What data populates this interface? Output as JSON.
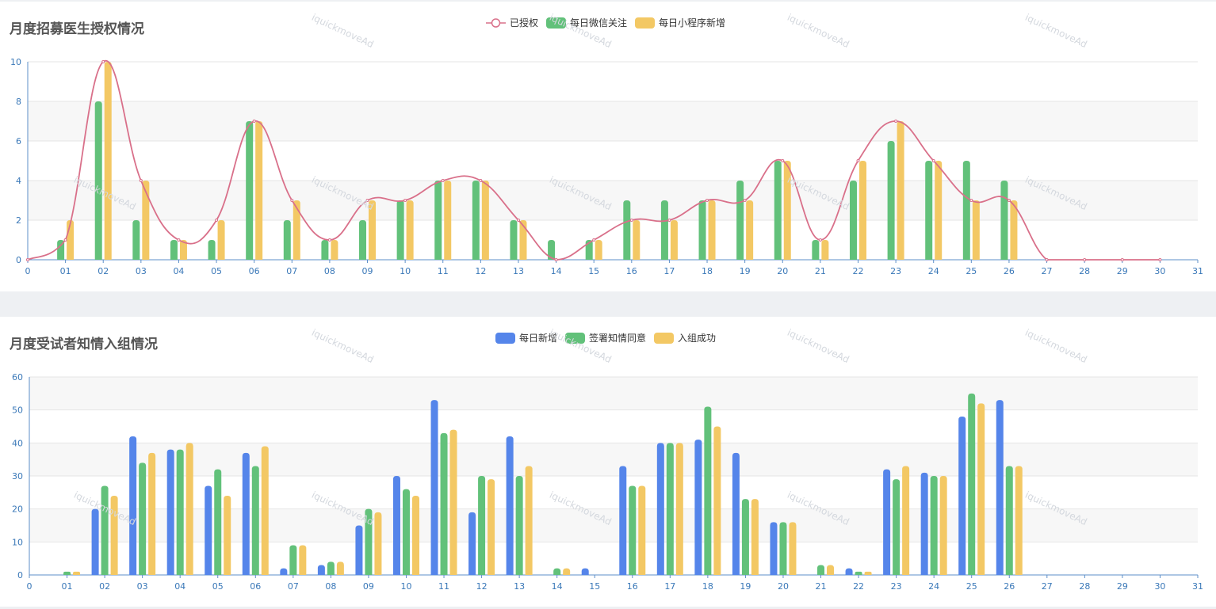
{
  "watermark": "iquickmoveAd",
  "colors": {
    "pink": "#d9708a",
    "green": "#62c17a",
    "yellow": "#f3c864",
    "blue": "#5585ea",
    "axis": "#5d8fc9",
    "label": "#3a78b8"
  },
  "chart_data": [
    {
      "type": "bar",
      "title": "月度招募医生授权情况",
      "x": [
        "0",
        "01",
        "02",
        "03",
        "04",
        "05",
        "06",
        "07",
        "08",
        "09",
        "10",
        "11",
        "12",
        "13",
        "14",
        "15",
        "16",
        "17",
        "18",
        "19",
        "20",
        "21",
        "22",
        "23",
        "24",
        "25",
        "26",
        "27",
        "28",
        "29",
        "30",
        "31"
      ],
      "ylim": [
        0,
        10
      ],
      "yticks": [
        0,
        2,
        4,
        6,
        8,
        10
      ],
      "legend": [
        "已授权",
        "每日微信关注",
        "每日小程序新增"
      ],
      "series": [
        {
          "name": "已授权",
          "type": "line",
          "smooth": true,
          "x_start": 0,
          "values": [
            0,
            1,
            10,
            4,
            1,
            2,
            7,
            3,
            1,
            3,
            3,
            4,
            4,
            2,
            0,
            1,
            2,
            2,
            3,
            3,
            5,
            1,
            5,
            7,
            5,
            3,
            3,
            0,
            0,
            0,
            0
          ]
        },
        {
          "name": "每日微信关注",
          "type": "bar",
          "x_start": 1,
          "values": [
            1,
            8,
            2,
            1,
            1,
            7,
            2,
            1,
            2,
            3,
            4,
            4,
            2,
            1,
            1,
            3,
            3,
            3,
            4,
            5,
            1,
            4,
            6,
            5,
            5,
            4
          ]
        },
        {
          "name": "每日小程序新增",
          "type": "bar",
          "x_start": 1,
          "values": [
            2,
            10,
            4,
            1,
            2,
            7,
            3,
            1,
            3,
            3,
            4,
            4,
            2,
            0,
            1,
            2,
            2,
            3,
            3,
            5,
            1,
            5,
            7,
            5,
            3,
            3
          ]
        }
      ]
    },
    {
      "type": "bar",
      "title": "月度受试者知情入组情况",
      "x": [
        "0",
        "01",
        "02",
        "03",
        "04",
        "05",
        "06",
        "07",
        "08",
        "09",
        "10",
        "11",
        "12",
        "13",
        "14",
        "15",
        "16",
        "17",
        "18",
        "19",
        "20",
        "21",
        "22",
        "23",
        "24",
        "25",
        "26",
        "27",
        "28",
        "29",
        "30",
        "31"
      ],
      "ylim": [
        0,
        60
      ],
      "yticks": [
        0,
        10,
        20,
        30,
        40,
        50,
        60
      ],
      "legend": [
        "每日新增",
        "签署知情同意",
        "入组成功"
      ],
      "series": [
        {
          "name": "每日新增",
          "type": "bar",
          "x_start": 1,
          "values": [
            0,
            20,
            42,
            38,
            27,
            37,
            2,
            3,
            15,
            30,
            53,
            19,
            42,
            0,
            2,
            33,
            40,
            41,
            37,
            16,
            0,
            2,
            32,
            31,
            48,
            53
          ]
        },
        {
          "name": "签署知情同意",
          "type": "bar",
          "x_start": 1,
          "values": [
            1,
            27,
            34,
            38,
            32,
            33,
            9,
            4,
            20,
            26,
            43,
            30,
            30,
            2,
            0,
            27,
            40,
            51,
            23,
            16,
            3,
            1,
            29,
            30,
            55,
            33
          ]
        },
        {
          "name": "入组成功",
          "type": "bar",
          "x_start": 1,
          "values": [
            1,
            24,
            37,
            40,
            24,
            39,
            9,
            4,
            19,
            24,
            44,
            29,
            33,
            2,
            0,
            27,
            40,
            45,
            23,
            16,
            3,
            1,
            33,
            30,
            52,
            33
          ]
        }
      ]
    }
  ]
}
